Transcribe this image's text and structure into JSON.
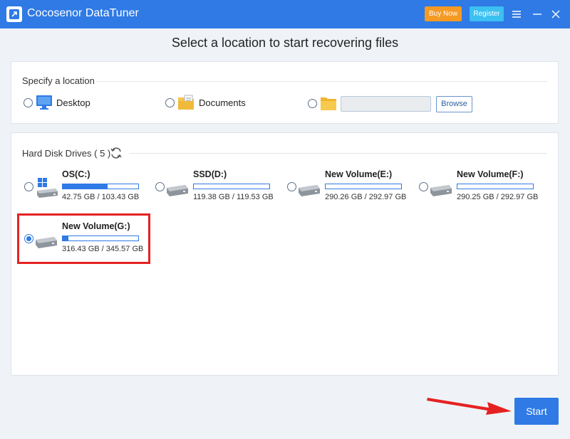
{
  "app": {
    "title": "Cocosenor DataTuner",
    "buy_now": "Buy Now",
    "register": "Register"
  },
  "heading": "Select a location to start recovering files",
  "location": {
    "section_title": "Specify a location",
    "options": [
      {
        "label": "Desktop",
        "icon": "desktop-icon"
      },
      {
        "label": "Documents",
        "icon": "documents-icon"
      },
      {
        "label": "",
        "icon": "folder-icon"
      }
    ],
    "path_value": "",
    "browse_label": "Browse"
  },
  "disks": {
    "section_title": "Hard Disk Drives ( 5 )",
    "drives": [
      {
        "name": "OS(C:)",
        "size": "42.75 GB / 103.43 GB",
        "used_fraction": 0.59,
        "selected": false,
        "icon": "windows-drive-icon"
      },
      {
        "name": "SSD(D:)",
        "size": "119.38 GB / 119.53 GB",
        "used_fraction": 0.0,
        "selected": false,
        "icon": "drive-icon"
      },
      {
        "name": "New Volume(E:)",
        "size": "290.26 GB / 292.97 GB",
        "used_fraction": 0.0,
        "selected": false,
        "icon": "drive-icon"
      },
      {
        "name": "New Volume(F:)",
        "size": "290.25 GB / 292.97 GB",
        "used_fraction": 0.0,
        "selected": false,
        "icon": "drive-icon"
      },
      {
        "name": "New Volume(G:)",
        "size": "316.43 GB / 345.57 GB",
        "used_fraction": 0.08,
        "selected": true,
        "icon": "drive-icon"
      }
    ]
  },
  "start_label": "Start",
  "colors": {
    "accent": "#2f7ae5",
    "buy": "#f59a23",
    "register": "#3bc0f2",
    "highlight": "#e52222"
  }
}
